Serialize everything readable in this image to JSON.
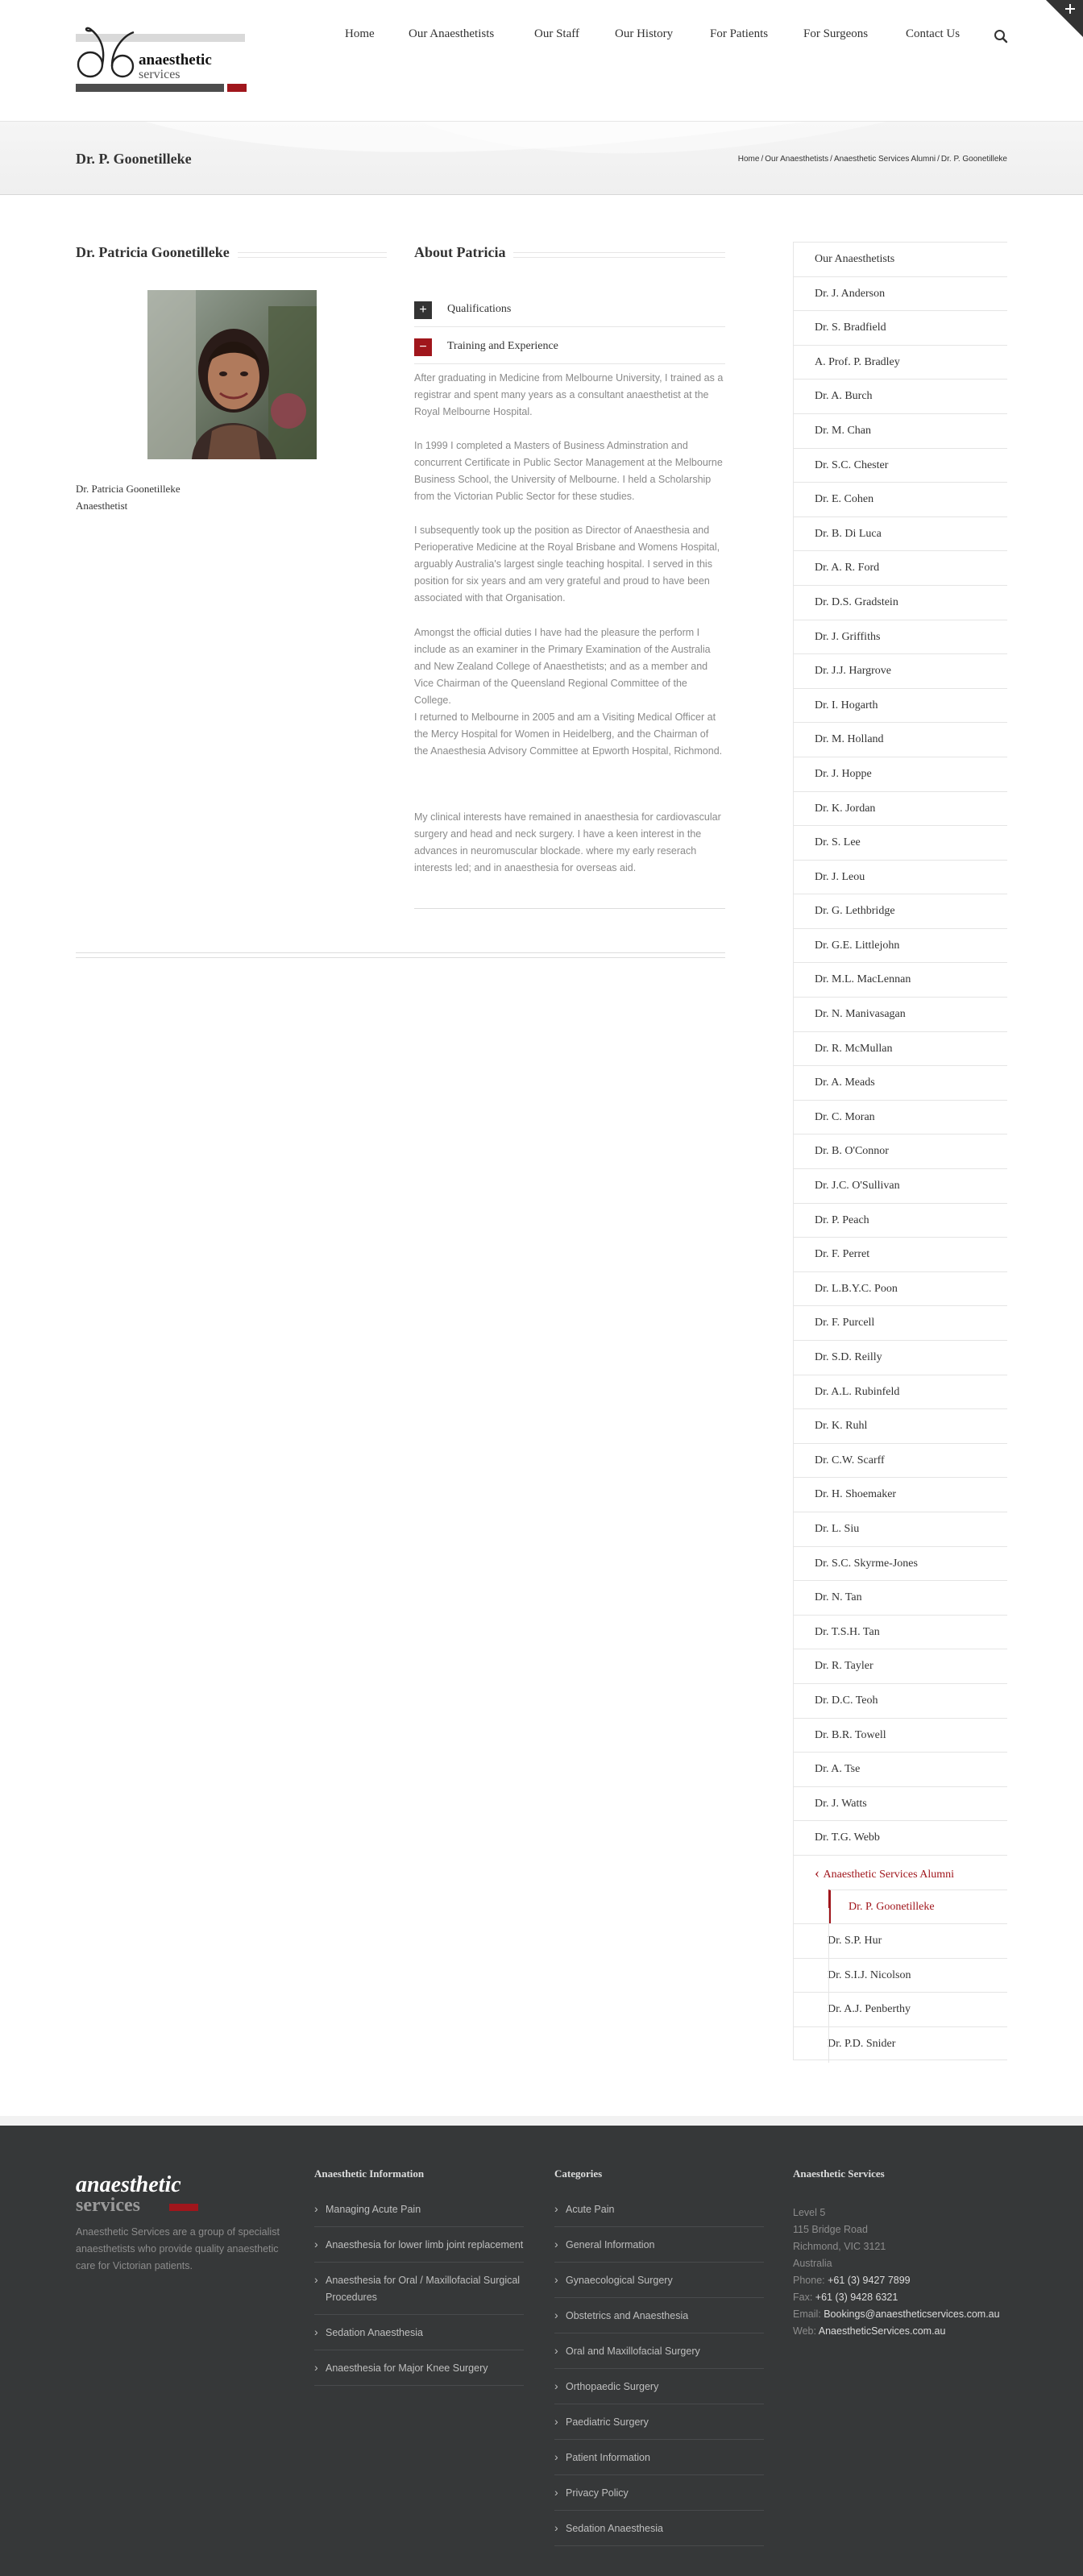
{
  "header": {
    "logo": {
      "line1": "anaesthetic",
      "line2": "services"
    },
    "nav": [
      {
        "label": "Home"
      },
      {
        "label": "Our Anaesthetists"
      },
      {
        "label": "Our Staff"
      },
      {
        "label": "Our History"
      },
      {
        "label": "For Patients"
      },
      {
        "label": "For Surgeons"
      },
      {
        "label": "Contact Us"
      }
    ],
    "search_icon": "search-icon",
    "toggle_icon": "plus-icon"
  },
  "title_bar": {
    "title": "Dr. P. Goonetilleke",
    "breadcrumb": [
      "Home",
      "Our Anaesthetists",
      "Anaesthetic Services Alumni",
      "Dr. P. Goonetilleke"
    ],
    "separator": "/"
  },
  "profile": {
    "heading": "Dr. Patricia Goonetilleke",
    "name": "Dr. Patricia Goonetilleke",
    "role": "Anaesthetist"
  },
  "about": {
    "heading": "About Patricia",
    "accordion": [
      {
        "label": "Qualifications",
        "expanded": false,
        "icon": "plus-icon"
      },
      {
        "label": "Training and Experience",
        "expanded": true,
        "icon": "minus-icon"
      }
    ],
    "paragraphs": [
      "After graduating in Medicine from Melbourne University, I trained as a registrar and spent many years as a consultant anaesthetist at the Royal Melbourne Hospital.",
      "In 1999 I completed a Masters of Business Adminstration and concurrent Certificate in Public Sector Management at the Melbourne Business School, the University of Melbourne. I held a Scholarship from the Victorian Public Sector for these studies.",
      "I subsequently took up the position as Director of Anaesthesia and Perioperative Medicine at the Royal Brisbane and Womens Hospital, arguably Australia's largest single teaching hospital. I served in this position for six years and am very grateful and proud to have been associated with that Organisation.",
      "Amongst the official duties I have had the pleasure the perform I include as an examiner in the Primary Examination of the Australia and New Zealand College of Anaesthetists; and as a member and Vice Chairman of the Queensland Regional Committee of the College.",
      "I returned to Melbourne in 2005 and am a Visiting Medical Officer at the Mercy Hospital for Women in Heidelberg, and the Chairman of the Anaesthesia Advisory Committee at Epworth Hospital, Richmond.",
      "My clinical interests have remained in anaesthesia for cardiovascular surgery and head and neck surgery. I have a keen interest in the advances in neuromuscular blockade. where my early reserach interests led; and in anaesthesia for overseas aid."
    ]
  },
  "sidebar": {
    "items": [
      {
        "label": "Our Anaesthetists",
        "kind": "top"
      },
      {
        "label": "Dr. J. Anderson",
        "kind": "item"
      },
      {
        "label": "Dr. S. Bradfield",
        "kind": "item"
      },
      {
        "label": "A. Prof. P. Bradley",
        "kind": "item"
      },
      {
        "label": "Dr. A. Burch",
        "kind": "item"
      },
      {
        "label": "Dr. M. Chan",
        "kind": "item"
      },
      {
        "label": "Dr. S.C. Chester",
        "kind": "item"
      },
      {
        "label": "Dr. E. Cohen",
        "kind": "item"
      },
      {
        "label": "Dr. B. Di Luca",
        "kind": "item"
      },
      {
        "label": "Dr. A. R. Ford",
        "kind": "item"
      },
      {
        "label": "Dr. D.S. Gradstein",
        "kind": "item"
      },
      {
        "label": "Dr. J. Griffiths",
        "kind": "item"
      },
      {
        "label": "Dr. J.J. Hargrove",
        "kind": "item"
      },
      {
        "label": "Dr. I. Hogarth",
        "kind": "item"
      },
      {
        "label": "Dr. M. Holland",
        "kind": "item"
      },
      {
        "label": "Dr. J. Hoppe",
        "kind": "item"
      },
      {
        "label": "Dr. K. Jordan",
        "kind": "item"
      },
      {
        "label": "Dr. S. Lee",
        "kind": "item"
      },
      {
        "label": "Dr. J. Leou",
        "kind": "item"
      },
      {
        "label": "Dr. G. Lethbridge",
        "kind": "item"
      },
      {
        "label": "Dr. G.E. Littlejohn",
        "kind": "item"
      },
      {
        "label": "Dr. M.L. MacLennan",
        "kind": "item"
      },
      {
        "label": "Dr. N. Manivasagan",
        "kind": "item"
      },
      {
        "label": "Dr. R. McMullan",
        "kind": "item"
      },
      {
        "label": "Dr. A. Meads",
        "kind": "item"
      },
      {
        "label": "Dr. C. Moran",
        "kind": "item"
      },
      {
        "label": "Dr. B. O'Connor",
        "kind": "item"
      },
      {
        "label": "Dr. J.C. O'Sullivan",
        "kind": "item"
      },
      {
        "label": "Dr. P. Peach",
        "kind": "item"
      },
      {
        "label": "Dr. F. Perret",
        "kind": "item"
      },
      {
        "label": "Dr. L.B.Y.C. Poon",
        "kind": "item"
      },
      {
        "label": "Dr. F. Purcell",
        "kind": "item"
      },
      {
        "label": "Dr. S.D. Reilly",
        "kind": "item"
      },
      {
        "label": "Dr. A.L. Rubinfeld",
        "kind": "item"
      },
      {
        "label": "Dr. K. Ruhl",
        "kind": "item"
      },
      {
        "label": "Dr. C.W. Scarff",
        "kind": "item"
      },
      {
        "label": "Dr. H. Shoemaker",
        "kind": "item"
      },
      {
        "label": "Dr. L. Siu",
        "kind": "item"
      },
      {
        "label": "Dr. S.C. Skyrme-Jones",
        "kind": "item"
      },
      {
        "label": "Dr. N. Tan",
        "kind": "item"
      },
      {
        "label": "Dr. T.S.H. Tan",
        "kind": "item"
      },
      {
        "label": "Dr. R. Tayler",
        "kind": "item"
      },
      {
        "label": "Dr. D.C. Teoh",
        "kind": "item"
      },
      {
        "label": "Dr. B.R. Towell",
        "kind": "item"
      },
      {
        "label": "Dr. A. Tse",
        "kind": "item"
      },
      {
        "label": "Dr. J. Watts",
        "kind": "item"
      },
      {
        "label": "Dr. T.G. Webb",
        "kind": "item"
      },
      {
        "label": "Anaesthetic Services Alumni",
        "kind": "active"
      },
      {
        "label": "Dr. P. Goonetilleke",
        "kind": "active-sub"
      },
      {
        "label": "Dr. S.P. Hur",
        "kind": "sub"
      },
      {
        "label": "Dr. S.I.J. Nicolson",
        "kind": "sub"
      },
      {
        "label": "Dr. A.J. Penberthy",
        "kind": "sub"
      },
      {
        "label": "Dr. P.D. Snider",
        "kind": "sub"
      }
    ],
    "active_icon": "chevron-left-icon"
  },
  "footer": {
    "logo": {
      "line1": "anaesthetic",
      "line2": "services"
    },
    "about": "Anaesthetic Services are a group of specialist anaesthetists who provide quality anaesthetic care for Victorian patients.",
    "info": {
      "title": "Anaesthetic Information",
      "links": [
        "Managing Acute Pain",
        "Anaesthesia for lower limb joint replacement",
        "Anaesthesia for Oral / Maxillofacial Surgical Procedures",
        "Sedation Anaesthesia",
        "Anaesthesia for Major Knee Surgery"
      ]
    },
    "categories": {
      "title": "Categories",
      "links": [
        "Acute Pain",
        "General Information",
        "Gynaecological Surgery",
        "Obstetrics and Anaesthesia",
        "Oral and Maxillofacial Surgery",
        "Orthopaedic Surgery",
        "Paediatric Surgery",
        "Patient Information",
        "Privacy Policy",
        "Sedation Anaesthesia"
      ]
    },
    "contact": {
      "title": "Anaesthetic Services",
      "address": [
        "Level 5",
        "115 Bridge Road",
        "Richmond, VIC 3121",
        "Australia"
      ],
      "phone_label": "Phone:",
      "phone": "+61 (3) 9427 7899",
      "fax_label": "Fax:",
      "fax": "+61 (3) 9428 6321",
      "email_label": "Email:",
      "email": "Bookings@anaestheticservices.com.au",
      "web_label": "Web:",
      "web": "AnaestheticServices.com.au"
    }
  },
  "colors": {
    "accent": "#a0161c",
    "dark": "#333333",
    "footer_bg": "#363839",
    "accordion_box": "#333333"
  }
}
